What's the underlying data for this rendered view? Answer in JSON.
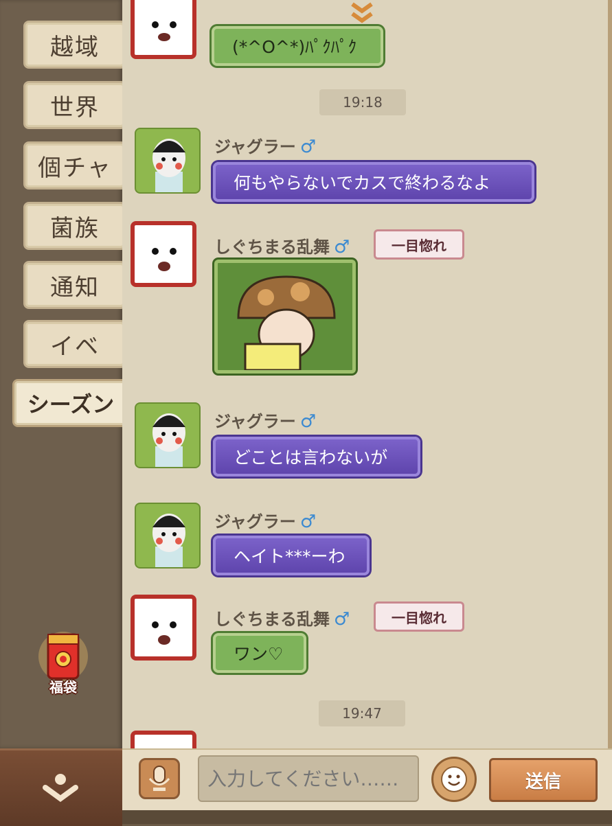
{
  "sidebar": {
    "tabs": [
      {
        "label": "越域"
      },
      {
        "label": "世界"
      },
      {
        "label": "個チャ"
      },
      {
        "label": "菌族"
      },
      {
        "label": "通知"
      },
      {
        "label": "イベ"
      },
      {
        "label": "シーズン",
        "active": true
      }
    ],
    "fukubukuro_label": "福袋"
  },
  "chat": {
    "timestamps": [
      "19:18",
      "19:47"
    ],
    "messages": [
      {
        "sender": "",
        "text": "(*^O^*)ﾊﾟｸﾊﾟｸ",
        "style": "green"
      },
      {
        "sender": "ジャグラー",
        "gender": "♂",
        "text": "何もやらないでカスで終わるなよ",
        "style": "purple"
      },
      {
        "sender": "しぐちまる乱舞",
        "gender": "♂",
        "badge": "一目惚れ",
        "style": "sticker"
      },
      {
        "sender": "ジャグラー",
        "gender": "♂",
        "text": "どことは言わないが",
        "style": "purple"
      },
      {
        "sender": "ジャグラー",
        "gender": "♂",
        "text": "ヘイト***ーわ",
        "style": "purple"
      },
      {
        "sender": "しぐちまる乱舞",
        "gender": "♂",
        "badge": "一目惚れ",
        "text": "ワン♡",
        "style": "green"
      }
    ]
  },
  "input": {
    "placeholder": "入力してください……",
    "send_label": "送信"
  }
}
